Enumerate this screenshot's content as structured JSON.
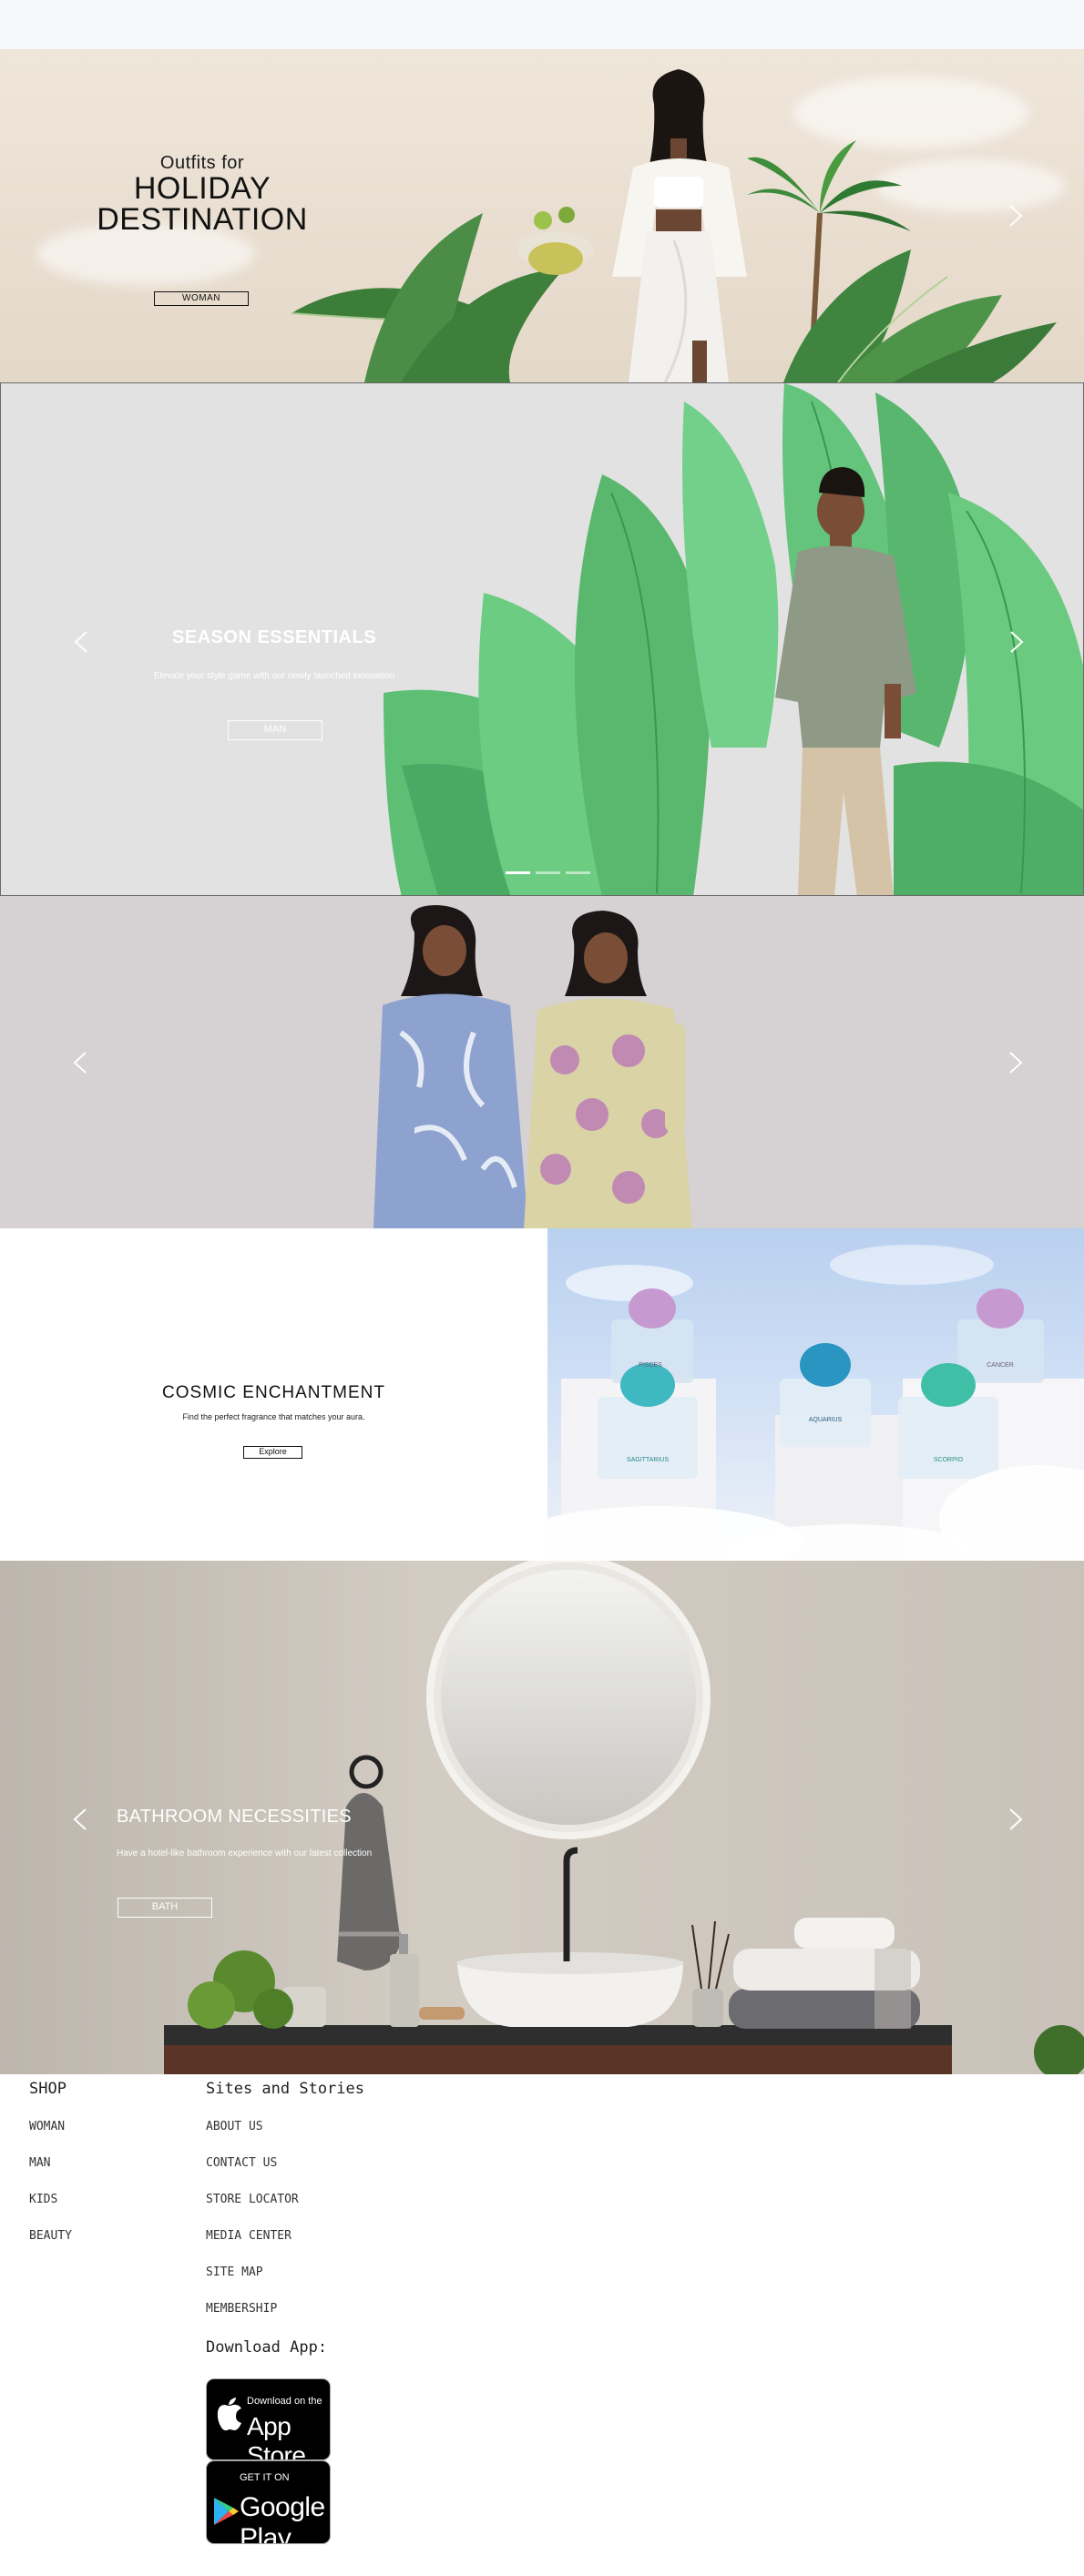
{
  "colors": {
    "topbar": "#f6f8fb",
    "slide1_bg": "#ebe2d4",
    "slide2_bg": "#e2e2e2",
    "slide3_bg": "#d6d1d2",
    "slide5_bg": "#c9c2b9",
    "leaf_green": "#4caf6a",
    "text_dark": "#111111",
    "text_light": "#ffffff"
  },
  "hero1": {
    "kicker": "Outfits for",
    "headline_line1": "HOLIDAY",
    "headline_line2": "DESTINATION",
    "button": "WOMAN"
  },
  "hero2": {
    "title": "SEASON ESSENTIALS",
    "subtitle": "Elevate your style game with our newly launched innovation",
    "button": "MAN",
    "slide_count": 3,
    "active_slide": 1
  },
  "hero3": {},
  "hero4": {
    "title": "COSMIC ENCHANTMENT",
    "subtitle": "Find the perfect fragrance that matches your aura.",
    "button": "Explore",
    "bottle_labels": [
      "PISCES",
      "AQUARIUS",
      "SAGITTARIUS",
      "CANCER",
      "SCORPIO"
    ]
  },
  "hero5": {
    "title": "BATHROOM NECESSITIES",
    "subtitle": "Have a hotel-like bathroom experience with our latest collection",
    "button": "BATH"
  },
  "footer": {
    "shop_title": "SHOP",
    "shop_links": [
      "WOMAN",
      "MAN",
      "KIDS",
      "BEAUTY"
    ],
    "sites_title": "Sites and Stories",
    "sites_links": [
      "ABOUT US",
      "CONTACT US",
      "STORE LOCATOR",
      "MEDIA CENTER",
      "SITE MAP",
      "MEMBERSHIP"
    ],
    "download_title": "Download App:",
    "appstore_small": "Download on the",
    "appstore_big": "App Store",
    "googleplay_small": "GET IT ON",
    "googleplay_big": "Google Play"
  }
}
